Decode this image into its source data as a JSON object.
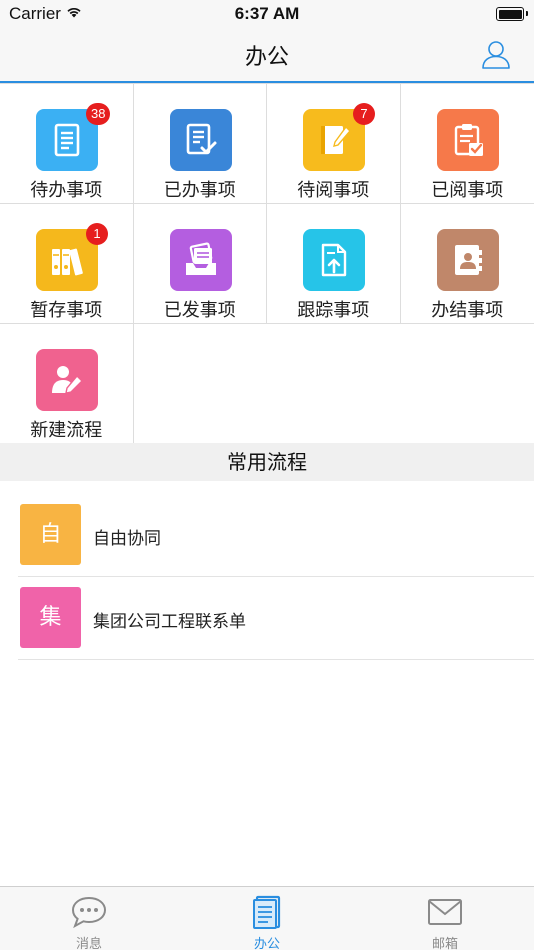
{
  "status_bar": {
    "carrier": "Carrier",
    "time": "6:37 AM",
    "battery_level": 1.0
  },
  "nav": {
    "title": "办公",
    "profile_icon": "user-icon"
  },
  "grid_items": [
    {
      "label": "待办事项",
      "color": "#3bb0f3",
      "icon": "document-list-icon",
      "badge": "38"
    },
    {
      "label": "已办事项",
      "color": "#3a86d8",
      "icon": "document-check-icon",
      "badge": ""
    },
    {
      "label": "待阅事项",
      "color": "#f7bb1d",
      "icon": "notebook-pen-icon",
      "badge": "7"
    },
    {
      "label": "已阅事项",
      "color": "#f6794a",
      "icon": "checklist-icon",
      "badge": ""
    },
    {
      "label": "暂存事项",
      "color": "#f5b81c",
      "icon": "binders-icon",
      "badge": "1"
    },
    {
      "label": "已发事项",
      "color": "#b45ee0",
      "icon": "inbox-tray-icon",
      "badge": ""
    },
    {
      "label": "跟踪事项",
      "color": "#26c4e8",
      "icon": "document-upload-icon",
      "badge": ""
    },
    {
      "label": "办结事项",
      "color": "#c0876a",
      "icon": "contact-book-icon",
      "badge": ""
    },
    {
      "label": "新建流程",
      "color": "#f0628f",
      "icon": "user-edit-icon",
      "badge": ""
    }
  ],
  "common_section": {
    "title": "常用流程"
  },
  "common_flows": [
    {
      "icon_char": "自",
      "label": "自由协同",
      "color": "#f8b443"
    },
    {
      "icon_char": "集",
      "label": "集团公司工程联系单",
      "color": "#f063a9"
    }
  ],
  "tab_bar": {
    "tabs": [
      {
        "label": "消息",
        "icon": "chat-bubble-icon",
        "active": false
      },
      {
        "label": "办公",
        "icon": "document-icon",
        "active": true
      },
      {
        "label": "邮箱",
        "icon": "mail-envelope-icon",
        "active": false
      }
    ]
  }
}
